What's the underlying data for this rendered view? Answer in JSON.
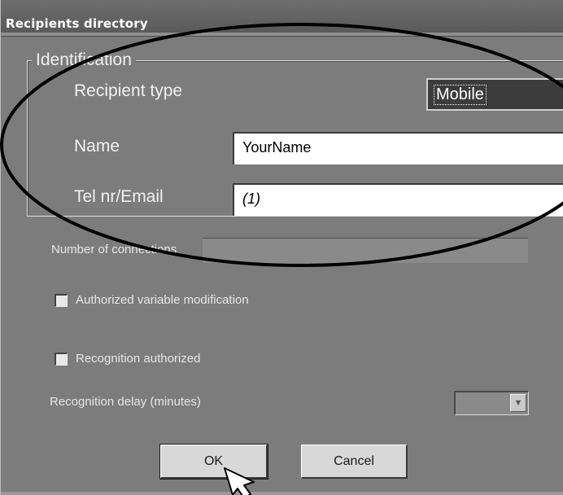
{
  "window": {
    "title": "Recipients directory"
  },
  "identification": {
    "legend": "Identification",
    "recipient_type_label": "Recipient type",
    "recipient_type_value": "Mobile",
    "name_label": "Name",
    "name_value": "YourName",
    "tel_label": "Tel nr/Email",
    "tel_value": "(1)"
  },
  "options": {
    "connections_label": "Number of connections",
    "authorized_label": "Authorized variable modification",
    "authorized_checked": false,
    "recognition_label": "Recognition authorized",
    "recognition_checked": false,
    "delay_label": "Recognition delay (minutes)",
    "delay_value": ""
  },
  "buttons": {
    "ok_label": "OK",
    "cancel_label": "Cancel"
  },
  "icons": {
    "combo_arrow": "chevron-down-icon",
    "pointer": "mouse-pointer-icon"
  },
  "colors": {
    "dialog_bg": "#7c7c7c",
    "titlebar": "#5f5f5f",
    "highlight_ellipse": "#000000"
  }
}
